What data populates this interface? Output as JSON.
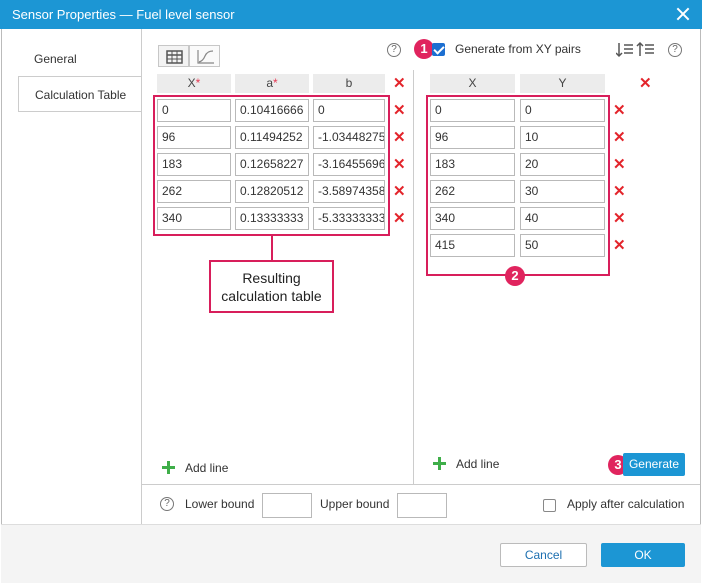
{
  "window": {
    "title": "Sensor Properties — Fuel level sensor"
  },
  "sidebar": {
    "tabs": [
      {
        "label": "General"
      },
      {
        "label": "Calculation Table"
      }
    ]
  },
  "left_table": {
    "headers": [
      {
        "label": "X",
        "required": "*"
      },
      {
        "label": "a",
        "required": "*"
      },
      {
        "label": "b"
      }
    ],
    "rows": [
      [
        "0",
        "0.10416666",
        "0"
      ],
      [
        "96",
        "0.11494252",
        "-1.03448275"
      ],
      [
        "183",
        "0.12658227",
        "-3.16455696"
      ],
      [
        "262",
        "0.12820512",
        "-3.58974358"
      ],
      [
        "340",
        "0.13333333",
        "-5.33333333"
      ]
    ],
    "add_line": "Add line"
  },
  "callout": {
    "line1": "Resulting",
    "line2": "calculation table"
  },
  "right_table": {
    "generate_label": "Generate from XY pairs",
    "headers": [
      {
        "label": "X"
      },
      {
        "label": "Y"
      }
    ],
    "rows": [
      [
        "0",
        "0"
      ],
      [
        "96",
        "10"
      ],
      [
        "183",
        "20"
      ],
      [
        "262",
        "30"
      ],
      [
        "340",
        "40"
      ],
      [
        "415",
        "50"
      ]
    ],
    "add_line": "Add line",
    "generate_button": "Generate"
  },
  "badges": [
    "1",
    "2",
    "3"
  ],
  "bounds": {
    "help": "?",
    "lower_label": "Lower bound",
    "upper_label": "Upper bound",
    "apply_label": "Apply after calculation"
  },
  "footer": {
    "cancel": "Cancel",
    "ok": "OK"
  },
  "delete_glyph": "✕",
  "colors": {
    "accent": "#1c96d4",
    "delete": "#e3242b",
    "highlight": "#d81e5b",
    "add": "#3fae49"
  }
}
